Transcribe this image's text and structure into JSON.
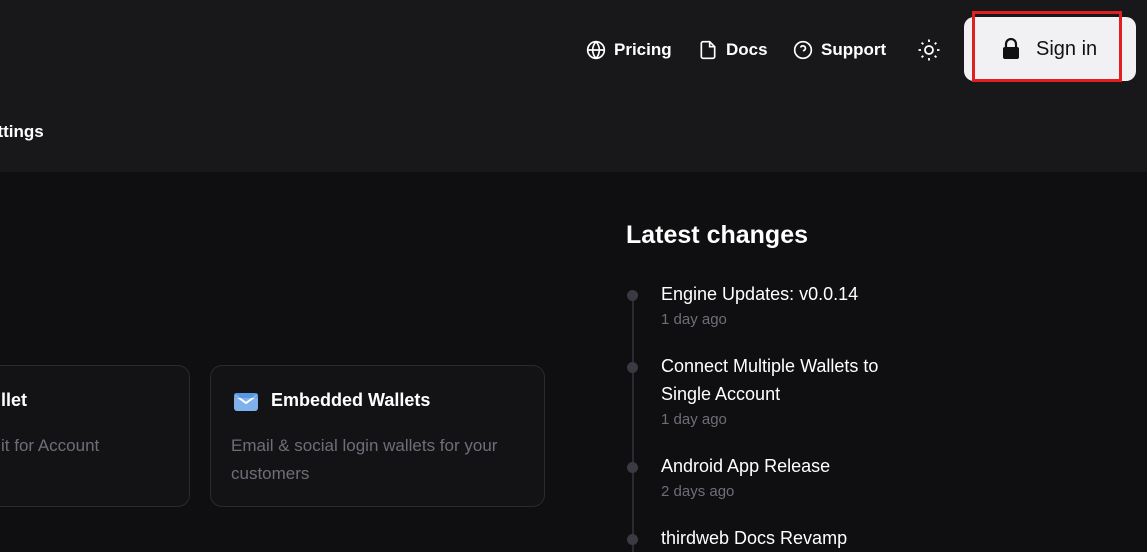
{
  "header": {
    "nav": [
      {
        "label": "Pricing",
        "icon": "globe-icon"
      },
      {
        "label": "Docs",
        "icon": "document-icon"
      },
      {
        "label": "Support",
        "icon": "help-circle-icon"
      }
    ],
    "theme_icon": "sun-icon",
    "sign_in": {
      "label": "Sign in",
      "icon": "lock-icon"
    }
  },
  "subnav": {
    "visible_item": "ettings"
  },
  "cards": [
    {
      "title": "llet",
      "description": "it for Account"
    },
    {
      "title": "Embedded Wallets",
      "description": "Email & social login wallets for your customers",
      "icon": "mail-icon"
    }
  ],
  "latest_changes": {
    "heading": "Latest changes",
    "items": [
      {
        "title": "Engine Updates: v0.0.14",
        "date": "1 day ago"
      },
      {
        "title": "Connect Multiple Wallets to Single Account",
        "date": "1 day ago"
      },
      {
        "title": "Android App Release",
        "date": "2 days ago"
      },
      {
        "title": "thirdweb Docs Revamp",
        "date": ""
      }
    ]
  },
  "colors": {
    "page_bg": "#0f0f11",
    "header_bg": "#18181b",
    "sign_in_bg": "#f1f1f3",
    "highlight": "#e02020",
    "muted_text": "#6e6e78"
  }
}
